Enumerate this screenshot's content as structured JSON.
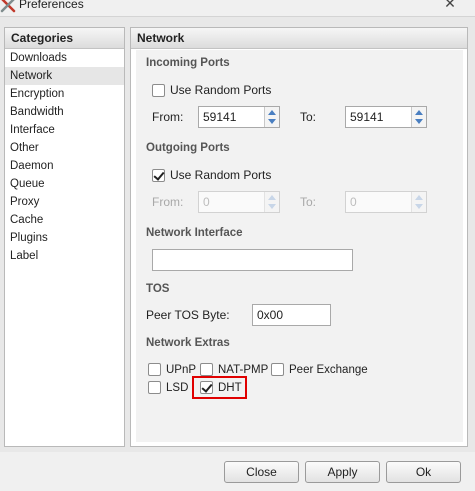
{
  "window": {
    "title": "Preferences"
  },
  "categories": {
    "header": "Categories",
    "items": [
      "Downloads",
      "Network",
      "Encryption",
      "Bandwidth",
      "Interface",
      "Other",
      "Daemon",
      "Queue",
      "Proxy",
      "Cache",
      "Plugins",
      "Label"
    ],
    "selected": "Network"
  },
  "network": {
    "header": "Network",
    "incoming": {
      "title": "Incoming Ports",
      "random_label": "Use Random Ports",
      "random_checked": false,
      "from_label": "From:",
      "from_value": "59141",
      "to_label": "To:",
      "to_value": "59141"
    },
    "outgoing": {
      "title": "Outgoing Ports",
      "random_label": "Use Random Ports",
      "random_checked": true,
      "from_label": "From:",
      "from_value": "0",
      "to_label": "To:",
      "to_value": "0"
    },
    "interface": {
      "title": "Network Interface",
      "value": ""
    },
    "tos": {
      "title": "TOS",
      "label": "Peer TOS Byte:",
      "value": "0x00"
    },
    "extras": {
      "title": "Network Extras",
      "upnp": {
        "label": "UPnP",
        "checked": false
      },
      "natpmp": {
        "label": "NAT-PMP",
        "checked": false
      },
      "peer_exchange": {
        "label": "Peer Exchange",
        "checked": false
      },
      "lsd": {
        "label": "LSD",
        "checked": false
      },
      "dht": {
        "label": "DHT",
        "checked": true
      }
    }
  },
  "buttons": {
    "close": "Close",
    "apply": "Apply",
    "ok": "Ok"
  },
  "colors": {
    "highlight": "#e00000",
    "spin_arrow": "#4a7fc1"
  }
}
